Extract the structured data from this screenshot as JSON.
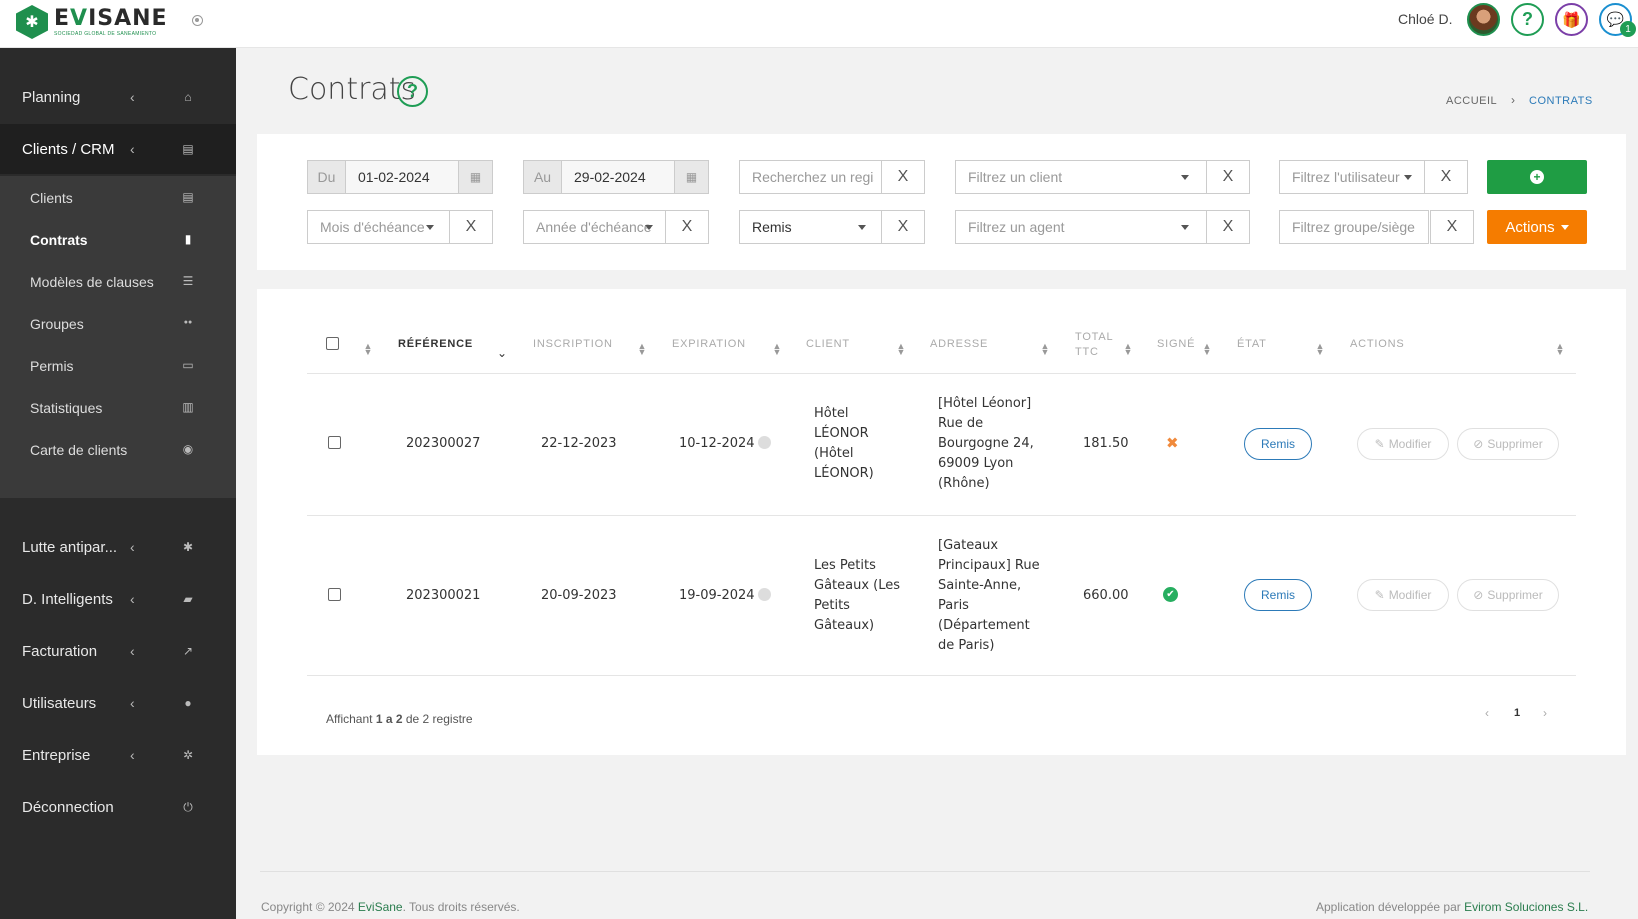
{
  "brand": {
    "name_prefix": "E",
    "name_v": "V",
    "name_suffix": "ISANE",
    "tagline": "SOCIEDAD GLOBAL DE SANEAMIENTO"
  },
  "topbar": {
    "user_name": "Chloé D.",
    "help_glyph": "?",
    "gift_glyph": "🎁",
    "chat_glyph": "💬",
    "chat_badge": "1"
  },
  "sidebar": {
    "items": [
      {
        "label": "Planning",
        "icon": "home-icon",
        "glyph": "⌂"
      },
      {
        "label": "Clients / CRM",
        "icon": "id-card-icon",
        "glyph": "▤"
      },
      {
        "label": "Lutte antipar...",
        "icon": "bug-icon",
        "glyph": "✱"
      },
      {
        "label": "D. Intelligents",
        "icon": "folder-icon",
        "glyph": "▰"
      },
      {
        "label": "Facturation",
        "icon": "chart-line-icon",
        "glyph": "↗"
      },
      {
        "label": "Utilisateurs",
        "icon": "user-icon",
        "glyph": "●"
      },
      {
        "label": "Entreprise",
        "icon": "gear-icon",
        "glyph": "✲"
      },
      {
        "label": "Déconnection",
        "icon": "power-icon",
        "glyph": "⏻"
      }
    ],
    "chevron": "‹",
    "submenu": [
      {
        "label": "Clients",
        "icon": "id-card-icon",
        "glyph": "▤"
      },
      {
        "label": "Contrats",
        "icon": "clipboard-icon",
        "glyph": "▮"
      },
      {
        "label": "Modèles de clauses",
        "icon": "list-icon",
        "glyph": "☰"
      },
      {
        "label": "Groupes",
        "icon": "users-icon",
        "glyph": "●●"
      },
      {
        "label": "Permis",
        "icon": "lock-icon",
        "glyph": "▭"
      },
      {
        "label": "Statistiques",
        "icon": "bar-chart-icon",
        "glyph": "▥"
      },
      {
        "label": "Carte de clients",
        "icon": "globe-icon",
        "glyph": "◉"
      }
    ]
  },
  "page": {
    "title": "Contrats",
    "help": "?"
  },
  "breadcrumb": {
    "home": "ACCUEIL",
    "sep": "›",
    "current": "CONTRATS"
  },
  "filters": {
    "from_label": "Du",
    "from_value": "01-02-2024",
    "to_label": "Au",
    "to_value": "29-02-2024",
    "search_placeholder": "Recherchez un registre",
    "client_placeholder": "Filtrez un client",
    "user_placeholder": "Filtrez l'utilisateur",
    "month_placeholder": "Mois d'échéance",
    "year_placeholder": "Année d'échéance",
    "state_value": "Remis",
    "agent_placeholder": "Filtrez un agent",
    "group_placeholder": "Filtrez groupe/siège",
    "clear": "X",
    "actions_label": "Actions",
    "add_glyph": "+"
  },
  "table": {
    "headers": [
      "RÉFÉRENCE",
      "INSCRIPTION",
      "EXPIRATION",
      "CLIENT",
      "ADRESSE",
      "TOTAL",
      "TTC",
      "SIGNÉ",
      "ÉTAT",
      "ACTIONS"
    ],
    "rows": [
      {
        "reference": "202300027",
        "inscription": "22-12-2023",
        "expiration": "10-12-2024",
        "client": [
          "Hôtel",
          "LÉONOR",
          "(Hôtel",
          "LÉONOR)"
        ],
        "address": [
          "[Hôtel Léonor]",
          "Rue de",
          "Bourgogne 24,",
          "69009 Lyon",
          "(Rhône)"
        ],
        "total": "181.50",
        "signed": false,
        "signed_glyph": "✖",
        "state": "Remis",
        "modify": "Modifier",
        "delete": "Supprimer"
      },
      {
        "reference": "202300021",
        "inscription": "20-09-2023",
        "expiration": "19-09-2024",
        "client": [
          "Les Petits",
          "Gâteaux (Les",
          "Petits",
          "Gâteaux)"
        ],
        "address": [
          "[Gateaux",
          "Principaux] Rue",
          "Sainte-Anne,",
          "Paris",
          "(Département",
          "de Paris)"
        ],
        "total": "660.00",
        "signed": true,
        "signed_glyph": "✔",
        "state": "Remis",
        "modify": "Modifier",
        "delete": "Supprimer"
      }
    ],
    "summary_pre": "Affichant ",
    "summary_from": "1",
    "summary_mid1": " a ",
    "summary_to": "2",
    "summary_mid2": " de 2 registre",
    "pager": {
      "prev": "‹",
      "page": "1",
      "next": "›"
    }
  },
  "footer": {
    "copyright_pre": "Copyright © 2024 ",
    "copyright_brand": "EviSane",
    "copyright_post": ". Tous droits réservés.",
    "dev_pre": "Application développée par ",
    "dev_brand": "Evirom Soluciones S.L."
  },
  "colors": {
    "accent_green": "#1f9d44",
    "actions_orange": "#f57c00",
    "link_blue": "#2c7ab8",
    "sidebar_bg": "#2b2b2b"
  }
}
